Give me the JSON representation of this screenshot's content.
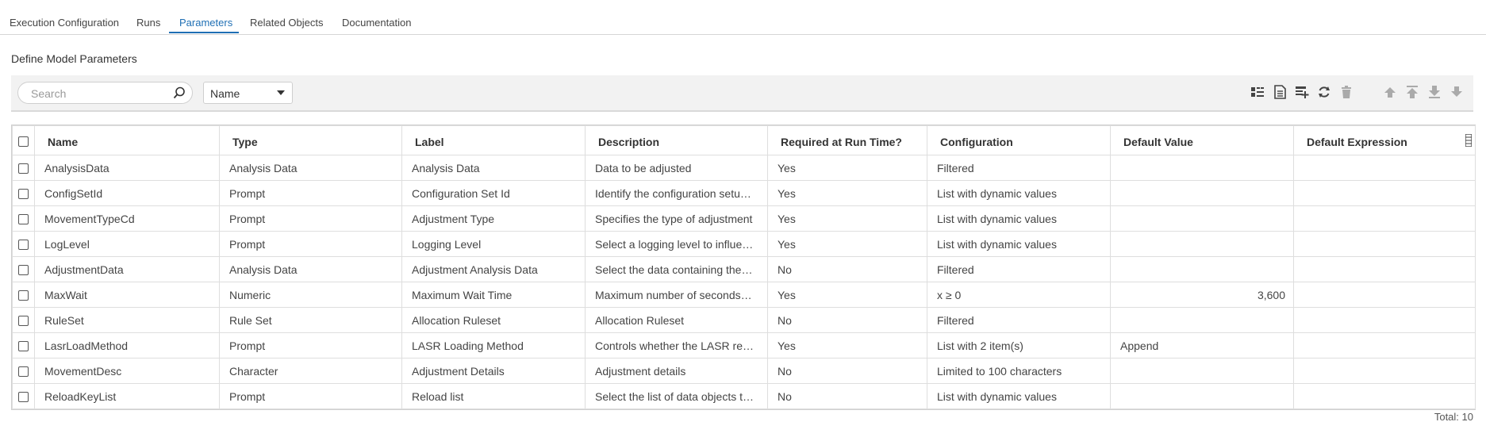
{
  "tabs": [
    {
      "label": "Execution Configuration",
      "active": false
    },
    {
      "label": "Runs",
      "active": false
    },
    {
      "label": "Parameters",
      "active": true
    },
    {
      "label": "Related Objects",
      "active": false
    },
    {
      "label": "Documentation",
      "active": false
    }
  ],
  "section_title": "Define Model Parameters",
  "toolbar": {
    "search_placeholder": "Search",
    "filter_select": "Name",
    "icons": [
      "columns-icon",
      "document-icon",
      "add-row-icon",
      "refresh-icon",
      "delete-icon",
      "move-up-icon",
      "move-top-icon",
      "move-bottom-icon",
      "move-down-icon"
    ]
  },
  "table": {
    "columns": [
      "Name",
      "Type",
      "Label",
      "Description",
      "Required at Run Time?",
      "Configuration",
      "Default Value",
      "Default Expression"
    ],
    "rows": [
      [
        "AnalysisData",
        "Analysis Data",
        "Analysis Data",
        "Data to be adjusted",
        "Yes",
        "Filtered",
        "",
        ""
      ],
      [
        "ConfigSetId",
        "Prompt",
        "Configuration Set Id",
        "Identify the configuration setu…",
        "Yes",
        "List with dynamic values",
        "",
        ""
      ],
      [
        "MovementTypeCd",
        "Prompt",
        "Adjustment Type",
        "Specifies the type of adjustment",
        "Yes",
        "List with dynamic values",
        "",
        ""
      ],
      [
        "LogLevel",
        "Prompt",
        "Logging Level",
        "Select a logging level to influe…",
        "Yes",
        "List with dynamic values",
        "",
        ""
      ],
      [
        "AdjustmentData",
        "Analysis Data",
        "Adjustment Analysis Data",
        "Select the data containing the…",
        "No",
        "Filtered",
        "",
        ""
      ],
      [
        "MaxWait",
        "Numeric",
        "Maximum Wait Time",
        "Maximum number of seconds…",
        "Yes",
        "x ≥ 0",
        "3,600",
        ""
      ],
      [
        "RuleSet",
        "Rule Set",
        "Allocation Ruleset",
        "Allocation Ruleset",
        "No",
        "Filtered",
        "",
        ""
      ],
      [
        "LasrLoadMethod",
        "Prompt",
        "LASR Loading Method",
        "Controls whether the LASR re…",
        "Yes",
        "List with 2 item(s)",
        "Append",
        ""
      ],
      [
        "MovementDesc",
        "Character",
        "Adjustment Details",
        "Adjustment details",
        "No",
        "Limited to 100 characters",
        "",
        ""
      ],
      [
        "ReloadKeyList",
        "Prompt",
        "Reload list",
        "Select the list of data objects t…",
        "No",
        "List with dynamic values",
        "",
        ""
      ]
    ]
  },
  "total": "Total: 10",
  "colors": {
    "accent": "#1f6fb4",
    "toolbar_bg": "#f2f2f2",
    "border": "#dedede"
  }
}
